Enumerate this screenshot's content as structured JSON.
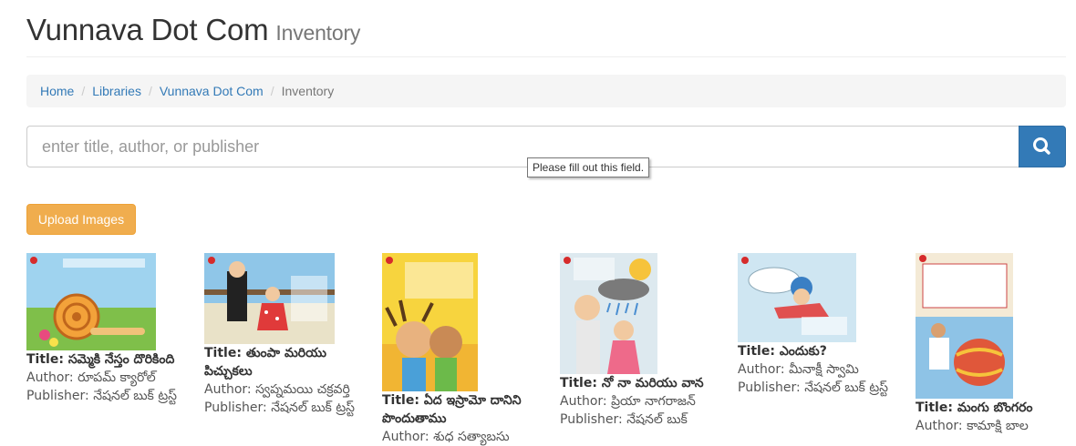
{
  "header": {
    "title": "Vunnava Dot Com",
    "subtitle": "Inventory"
  },
  "breadcrumb": {
    "items": [
      "Home",
      "Libraries",
      "Vunnava Dot Com"
    ],
    "active": "Inventory",
    "separator": "/"
  },
  "search": {
    "placeholder": "enter title, author, or publisher",
    "value": "",
    "tooltip": "Please fill out this field.",
    "icon": "search-icon"
  },
  "actions": {
    "upload_label": "Upload Images"
  },
  "labels": {
    "title": "Title:",
    "author": "Author:",
    "publisher": "Publisher:"
  },
  "colors": {
    "primary": "#337ab7",
    "warning": "#f0ad4e",
    "link": "#337ab7"
  },
  "books": [
    {
      "title": "సమ్మెకి నేస్తం దొరికింది",
      "author": "రూపమ్ క్యారోల్",
      "publisher": "నేషనల్ బుక్ ట్రస్ట్"
    },
    {
      "title": "తుంపా మరియు పిచ్చుకలు",
      "author": "స్వప్నమయి చక్రవర్తి",
      "publisher": "నేషనల్ బుక్ ట్రస్ట్"
    },
    {
      "title": "ఏద ఇస్రామో దానిని పొందుతాము",
      "author": "శుధ సత్యాబసు",
      "publisher": ""
    },
    {
      "title": "నో నా మరియు వాన",
      "author": "ప్రియా నాగరాజన్",
      "publisher": "నేషనల్ బుక్"
    },
    {
      "title": "ఎందుకు?",
      "author": "మీనాక్షీ స్వామి",
      "publisher": "నేషనల్ బుక్ ట్రస్ట్"
    },
    {
      "title": "మంగు బొంగరం",
      "author": "కామాక్షి బాల",
      "publisher": ""
    }
  ]
}
